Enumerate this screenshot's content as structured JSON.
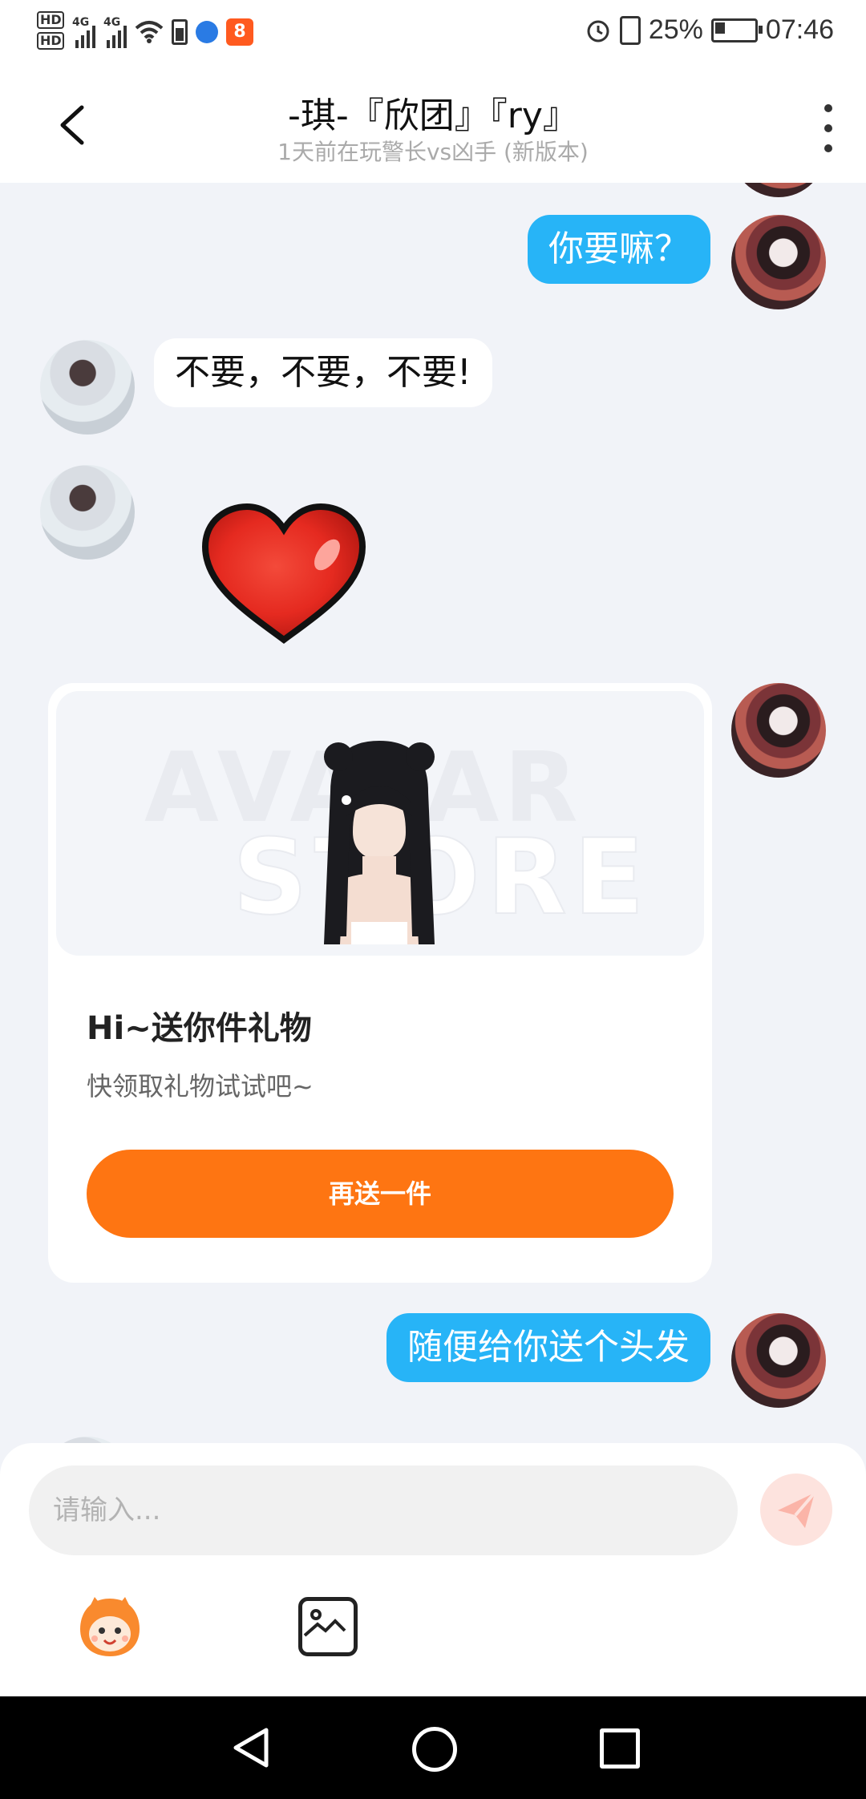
{
  "status_bar": {
    "network_1": "4G",
    "network_2": "4G",
    "hd_1": "HD",
    "hd_2": "HD",
    "battery": "25%",
    "time": "07:46",
    "app_badge": "8"
  },
  "header": {
    "title": "-琪-『欣团』『ry』",
    "subtitle": "1天前在玩警长vs凶手 (新版本)"
  },
  "messages": [
    {
      "side": "me",
      "text": "你要嘛？"
    },
    {
      "side": "other",
      "text": "不要，不要，不要!"
    },
    {
      "side": "other",
      "type": "sticker",
      "sticker": "red-heart"
    }
  ],
  "gift_card": {
    "watermark_1": "AVATAR",
    "watermark_2": "STORE",
    "title": "Hi~送你件礼物",
    "subtitle": "快领取礼物试试吧~",
    "button_label": "再送一件"
  },
  "last_message": {
    "side": "me",
    "text": "随便给你送个头发"
  },
  "input": {
    "placeholder": "请输入..."
  },
  "colors": {
    "me_bubble": "#27b4f7",
    "accent_orange": "#fe7512",
    "background": "#f1f3f8"
  }
}
